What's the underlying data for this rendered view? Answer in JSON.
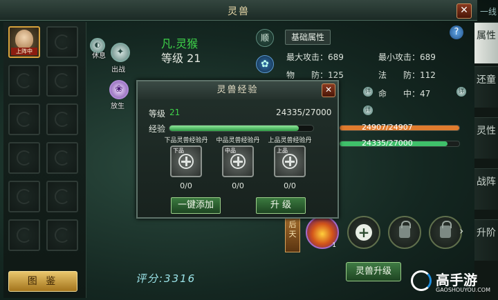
{
  "window": {
    "title": "灵兽",
    "close": "✕",
    "corner_tab": "一线"
  },
  "left_panel": {
    "active_slot_tag": "上阵中",
    "atlas_button": "图 鉴"
  },
  "pet": {
    "name": "凡.灵猴",
    "level_label": "等级 21",
    "icon_labels": {
      "retire": "出战",
      "release": "放生",
      "rest": "休息"
    },
    "shun_icon": "顺",
    "score": "评分:3316"
  },
  "attributes": {
    "tab_label": "基础属性",
    "max_attack": "最大攻击：689",
    "min_attack": "最小攻击：689",
    "phys_def": "物　　防：125",
    "magic_def": "法　　防：112",
    "hit": "命　　中：47",
    "hp_bar": {
      "text": "24907/24907",
      "fraction": 1.0,
      "color": "#e07b2e"
    },
    "exp_bar": {
      "text": "24335/27000",
      "fraction": 0.901,
      "color": "#3fc06a"
    }
  },
  "skills": {
    "passive_tag": "后天",
    "fire_skill_count": "1"
  },
  "upgrade_button": "灵兽升级",
  "tabs": [
    "属性",
    "还童",
    "灵性",
    "战阵",
    "升阶"
  ],
  "popup": {
    "title": "灵兽经验",
    "level_label": "等级",
    "level_value": "21",
    "exp_value": "24335/27000",
    "exp_label": "经验",
    "exp_fraction": 0.9,
    "items": [
      {
        "label": "下品灵兽经验丹",
        "grade": "下品",
        "count": "0/0"
      },
      {
        "label": "中品灵兽经验丹",
        "grade": "中品",
        "count": "0/0"
      },
      {
        "label": "上品灵兽经验丹",
        "grade": "上品",
        "count": "0/0"
      }
    ],
    "add_all_button": "一键添加",
    "upgrade_button": "升 级"
  },
  "watermark": {
    "name": "高手游",
    "url": "GAOSHOUYOU.COM"
  }
}
